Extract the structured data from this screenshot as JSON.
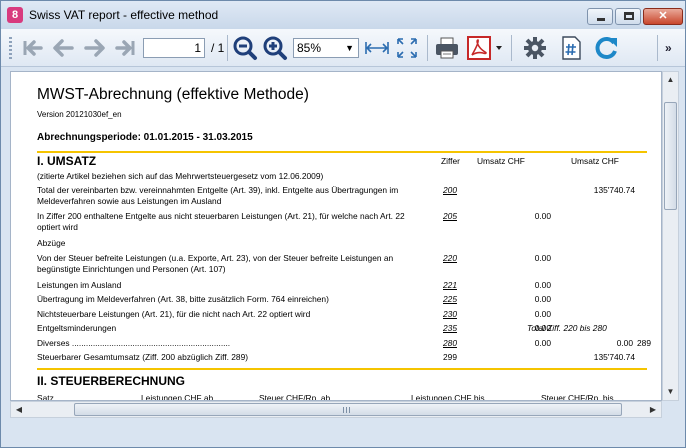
{
  "window": {
    "title": "Swiss VAT report - effective method",
    "app_icon_letter": "8",
    "minimize_label": "",
    "maximize_label": "",
    "close_label": "✕"
  },
  "toolbar": {
    "page_current": "1",
    "page_total": "/ 1",
    "zoom_value": "85%",
    "more_label": "»",
    "icons": [
      "first-page-icon",
      "previous-page-icon",
      "next-page-icon",
      "last-page-icon",
      "zoom-out-icon",
      "zoom-in-icon",
      "fit-width-icon",
      "fit-page-icon",
      "print-icon",
      "pdf-icon",
      "pdf-dropdown-icon",
      "settings-icon",
      "page-number-icon",
      "refresh-icon"
    ],
    "accent_colors": {
      "zoom": "#1f3f7a",
      "pdf": "#c62828",
      "refresh": "#1e88c8",
      "fit": "#2b6cb0"
    }
  },
  "report": {
    "title": "MWST-Abrechnung (effektive Methode)",
    "version": "Version 20121030ef_en",
    "period": "Abrechnungsperiode: 01.01.2015 - 31.03.2015",
    "rule_color": "#f5c400",
    "section1": {
      "heading": "I. UMSATZ",
      "col_ziffer": "Ziffer",
      "col_umsatz1": "Umsatz CHF",
      "col_umsatz2": "Umsatz CHF",
      "rows": [
        {
          "desc": "(zitierte Artikel beziehen sich auf das Mehrwertsteuergesetz vom 12.06.2009)",
          "code": "",
          "val1": "",
          "val2": ""
        },
        {
          "desc": "Total der vereinbarten bzw. vereinnahmten Entgelte (Art. 39), inkl. Entgelte aus Übertragungen im Meldeverfahren sowie aus Leistungen im Ausland",
          "code": "200",
          "val1": "",
          "val2": "135'740.74"
        },
        {
          "desc": "In Ziffer 200 enthaltene Entgelte aus nicht steuerbaren Leistungen (Art. 21), für welche nach Art. 22 optiert wird",
          "code": "205",
          "val1": "0.00",
          "val2": ""
        },
        {
          "desc": "Abzüge",
          "code": "",
          "val1": "",
          "val2": ""
        },
        {
          "desc": "Von der Steuer befreite Leistungen (u.a. Exporte, Art. 23), von der Steuer befreite Leistungen an begünstigte Einrichtungen und Personen (Art. 107)",
          "code": "220",
          "val1": "0.00",
          "val2": ""
        },
        {
          "desc": "Leistungen im Ausland",
          "code": "221",
          "val1": "0.00",
          "val2": ""
        },
        {
          "desc": "Übertragung im Meldeverfahren (Art. 38, bitte zusätzlich Form. 764 einreichen)",
          "code": "225",
          "val1": "0.00",
          "val2": ""
        },
        {
          "desc": "Nichtsteuerbare Leistungen (Art. 21), für die nicht nach Art. 22 optiert wird",
          "code": "230",
          "val1": "0.00",
          "val2": ""
        },
        {
          "desc": "Entgeltsminderungen",
          "code": "235",
          "val1": "0.00",
          "note": "Total Ziff. 220 bis 280"
        },
        {
          "desc": "Diverses ....................................................................",
          "code": "280",
          "val1": "0.00",
          "val2": "0.00",
          "extra": "289"
        },
        {
          "desc": "Steuerbarer Gesamtumsatz (Ziff. 200 abzüglich Ziff. 289)",
          "code": "299",
          "val1": "",
          "val2": "135'740.74"
        }
      ]
    },
    "section2": {
      "heading": "II. STEUERBERECHNUNG",
      "col_satz": "Satz",
      "col_leistungen_ab": "Leistungen CHF ab",
      "col_steuer_ab": "Steuer CHF/Rp. ab",
      "col_leistungen_bis": "Leistungen CHF bis",
      "col_steuer_bis": "Steuer CHF/Rp. bis"
    }
  },
  "scroll": {
    "up": "▲",
    "down": "▼",
    "left": "◀",
    "right": "▶"
  }
}
